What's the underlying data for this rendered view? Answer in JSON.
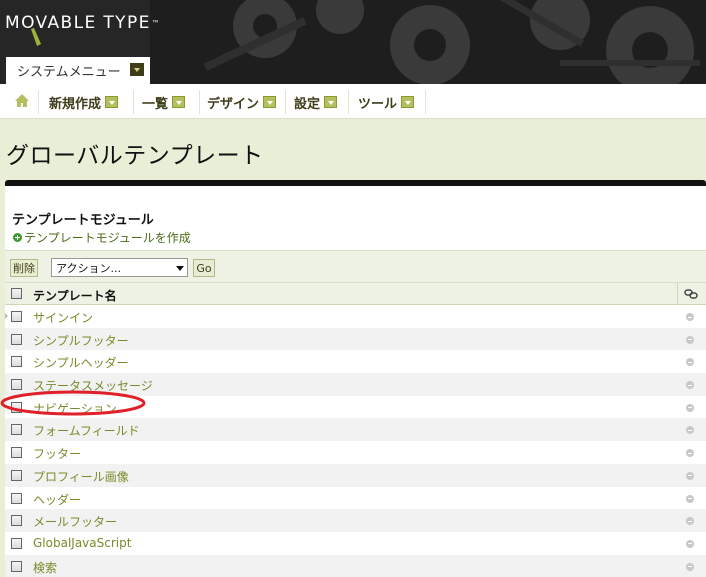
{
  "header": {
    "logo_text": "MOVABLE TYPE",
    "logo_trademark": "™",
    "system_menu_label": "システムメニュー"
  },
  "nav": {
    "home_icon": "home-icon",
    "items": [
      {
        "label": "新規作成"
      },
      {
        "label": "一覧"
      },
      {
        "label": "デザイン"
      },
      {
        "label": "設定"
      },
      {
        "label": "ツール"
      }
    ]
  },
  "page": {
    "title": "グローバルテンプレート"
  },
  "listing": {
    "section_title": "テンプレートモジュール",
    "create_link": "テンプレートモジュールを作成",
    "delete_button": "削除",
    "action_select": "アクション...",
    "go_button": "Go",
    "column_header": "テンプレート名",
    "rows": [
      {
        "name": "サインイン"
      },
      {
        "name": "シンプルフッター"
      },
      {
        "name": "シンプルヘッダー"
      },
      {
        "name": "ステータスメッセージ"
      },
      {
        "name": "ナビゲーション"
      },
      {
        "name": "フォームフィールド"
      },
      {
        "name": "フッター"
      },
      {
        "name": "プロフィール画像"
      },
      {
        "name": "ヘッダー"
      },
      {
        "name": "メールフッター"
      },
      {
        "name": "GlobalJavaScript"
      },
      {
        "name": "検索"
      }
    ]
  },
  "colors": {
    "accent_olive": "#8a9a2f",
    "link_text": "#7a8a2a",
    "highlight_circle": "#e0202a",
    "page_bg": "#e9eed6"
  }
}
